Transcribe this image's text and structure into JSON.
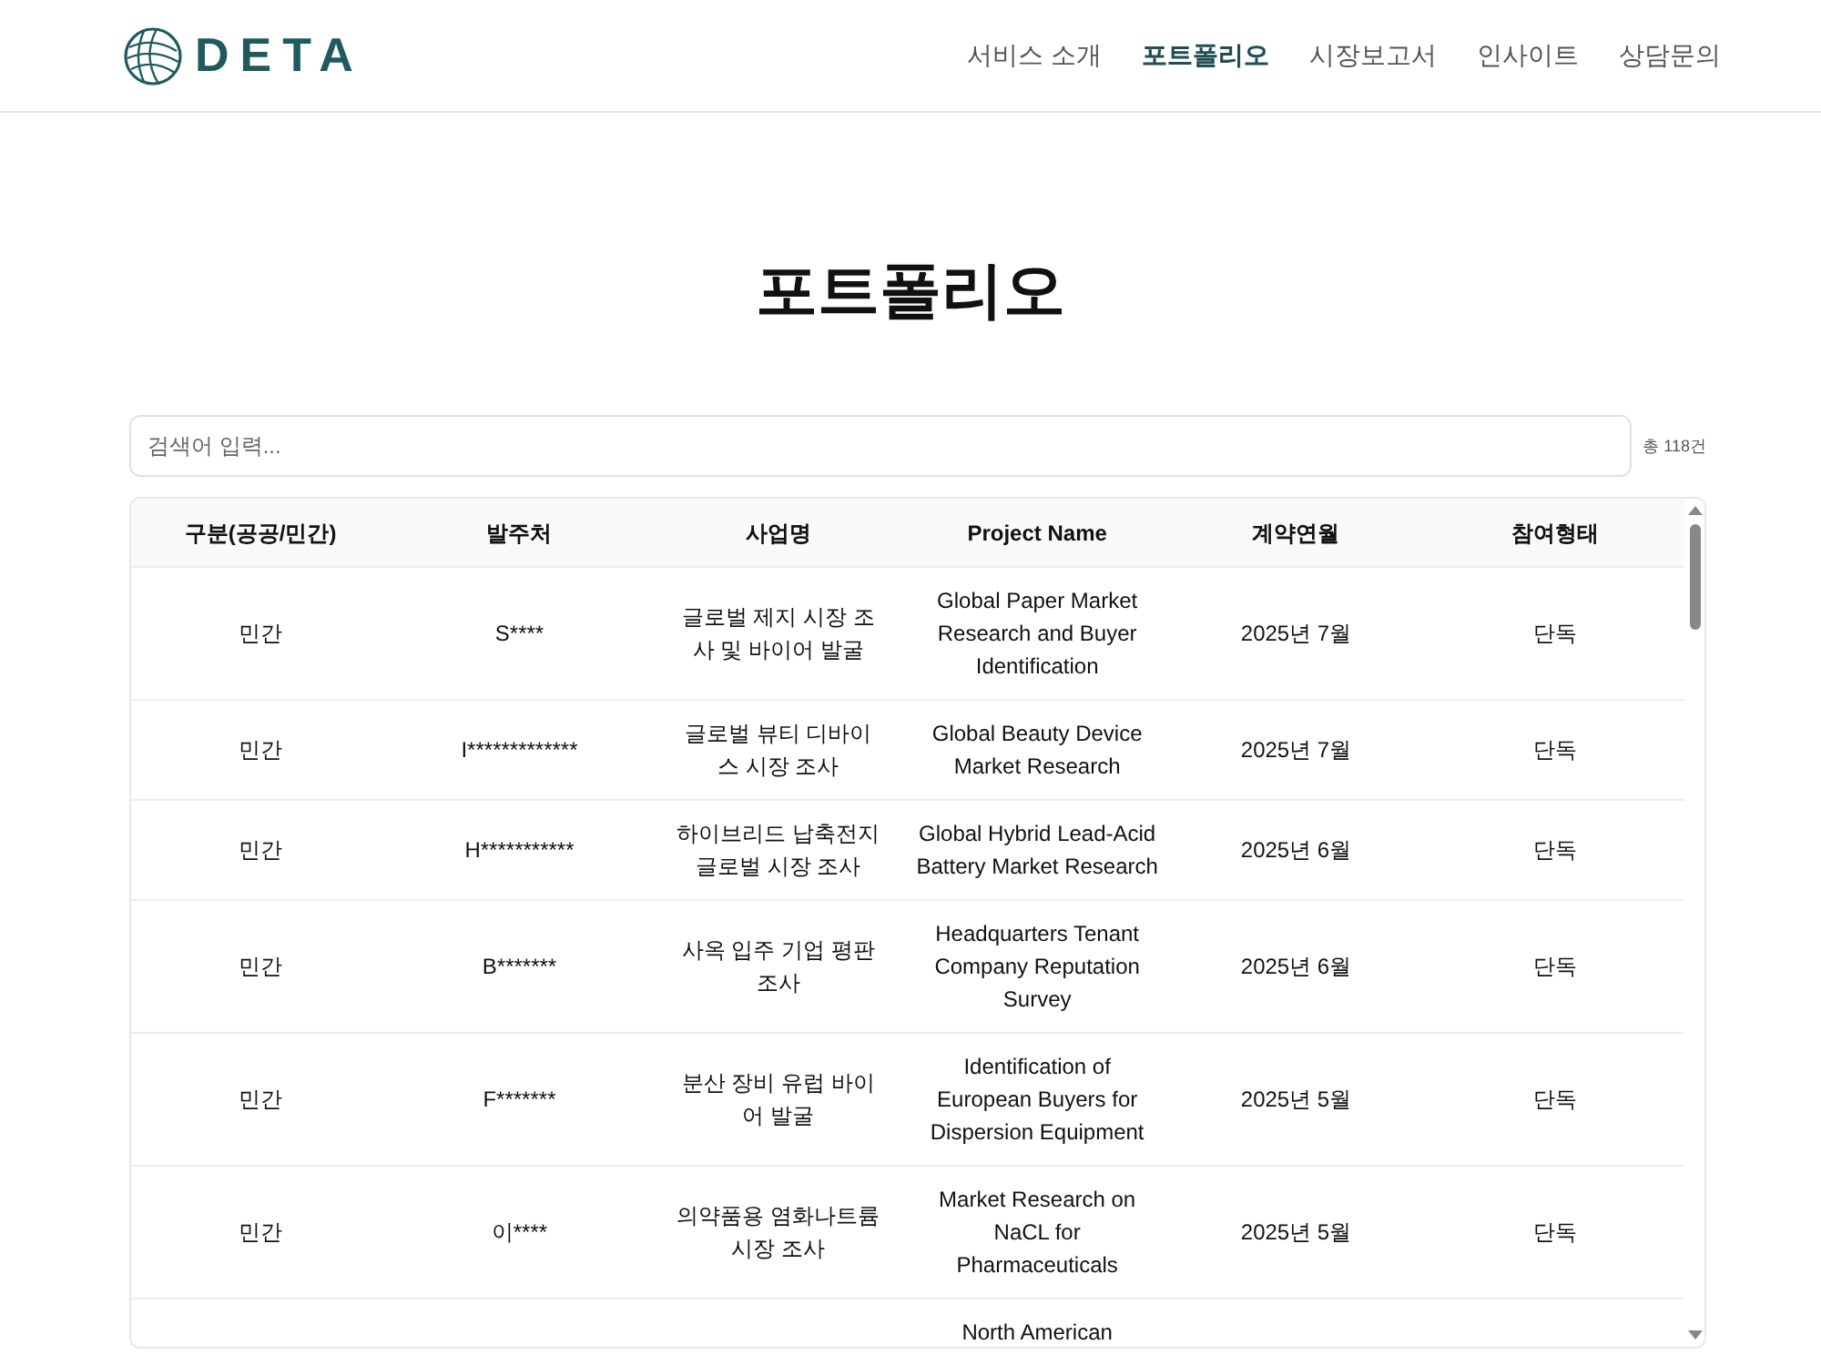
{
  "header": {
    "logo": "DETA",
    "nav": [
      {
        "label": "서비스 소개",
        "selected": false
      },
      {
        "label": "포트폴리오",
        "selected": true
      },
      {
        "label": "시장보고서",
        "selected": false
      },
      {
        "label": "인사이트",
        "selected": false
      },
      {
        "label": "상담문의",
        "selected": false
      }
    ]
  },
  "title": "포트폴리오",
  "search": {
    "placeholder": "검색어 입력...",
    "count": "총 118건"
  },
  "table": {
    "columns": [
      "구분(공공/민간)",
      "발주처",
      "사업명",
      "Project Name",
      "계약연월",
      "참여형태"
    ],
    "rows": [
      {
        "cells": [
          "민간",
          "S****",
          "글로벌 제지 시장 조사 및 바이어 발굴",
          "Global Paper Market Research and Buyer Identification",
          "2025년 7월",
          "단독"
        ]
      },
      {
        "cells": [
          "민간",
          "I*************",
          "글로벌 뷰티 디바이스 시장 조사",
          "Global Beauty Device Market Research",
          "2025년 7월",
          "단독"
        ]
      },
      {
        "cells": [
          "민간",
          "H***********",
          "하이브리드 납축전지 글로벌 시장 조사",
          "Global Hybrid Lead-Acid Battery Market Research",
          "2025년 6월",
          "단독"
        ]
      },
      {
        "cells": [
          "민간",
          "B*******",
          "사옥 입주 기업 평판 조사",
          "Headquarters Tenant Company Reputation Survey",
          "2025년 6월",
          "단독"
        ]
      },
      {
        "cells": [
          "민간",
          "F*******",
          "분산 장비 유럽 바이어 발굴",
          "Identification of European Buyers for Dispersion Equipment",
          "2025년 5월",
          "단독"
        ]
      },
      {
        "cells": [
          "민간",
          "이****",
          "의약품용 염화나트륨 시장 조사",
          "Market Research on NaCL for Pharmaceuticals",
          "2025년 5월",
          "단독"
        ]
      }
    ],
    "partial_row": {
      "project_name": "North American"
    }
  }
}
